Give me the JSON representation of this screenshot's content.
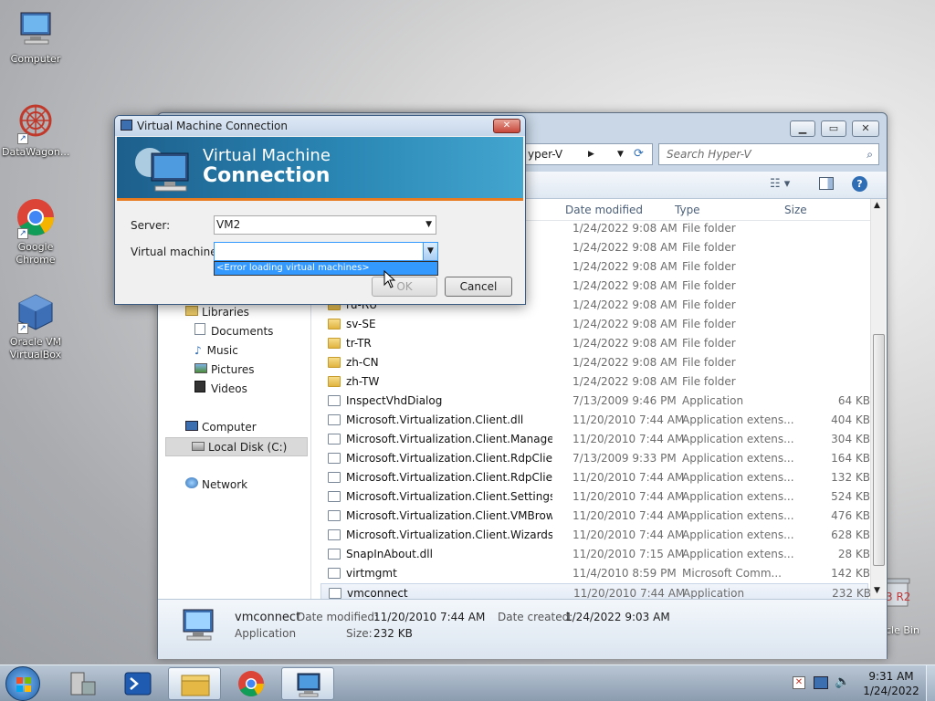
{
  "desktop": {
    "icons": [
      {
        "label": "Computer"
      },
      {
        "label": "DataWagon..."
      },
      {
        "label": "Google Chrome"
      },
      {
        "label": "Oracle VM VirtualBox"
      }
    ],
    "recycle_bin_label": "cle Bin",
    "partial_text_r2": "3 R2"
  },
  "explorer": {
    "address_crumb": "yper-V",
    "search_placeholder": "Search Hyper-V",
    "columns": {
      "date": "Date modified",
      "type": "Type",
      "size": "Size"
    },
    "nav": {
      "libraries": "Libraries",
      "documents": "Documents",
      "music": "Music",
      "pictures": "Pictures",
      "videos": "Videos",
      "computer": "Computer",
      "local_disk": "Local Disk (C:)",
      "network": "Network"
    },
    "rows": [
      {
        "name": "",
        "date": "1/24/2022 9:08 AM",
        "type": "File folder",
        "size": "",
        "icon": "folder"
      },
      {
        "name": "",
        "date": "1/24/2022 9:08 AM",
        "type": "File folder",
        "size": "",
        "icon": "folder"
      },
      {
        "name": "",
        "date": "1/24/2022 9:08 AM",
        "type": "File folder",
        "size": "",
        "icon": "folder"
      },
      {
        "name": "",
        "date": "1/24/2022 9:08 AM",
        "type": "File folder",
        "size": "",
        "icon": "folder"
      },
      {
        "name": "ru-RU",
        "date": "1/24/2022 9:08 AM",
        "type": "File folder",
        "size": "",
        "icon": "folder"
      },
      {
        "name": "sv-SE",
        "date": "1/24/2022 9:08 AM",
        "type": "File folder",
        "size": "",
        "icon": "folder"
      },
      {
        "name": "tr-TR",
        "date": "1/24/2022 9:08 AM",
        "type": "File folder",
        "size": "",
        "icon": "folder"
      },
      {
        "name": "zh-CN",
        "date": "1/24/2022 9:08 AM",
        "type": "File folder",
        "size": "",
        "icon": "folder"
      },
      {
        "name": "zh-TW",
        "date": "1/24/2022 9:08 AM",
        "type": "File folder",
        "size": "",
        "icon": "folder"
      },
      {
        "name": "InspectVhdDialog",
        "date": "7/13/2009 9:46 PM",
        "type": "Application",
        "size": "64 KB",
        "icon": "file"
      },
      {
        "name": "Microsoft.Virtualization.Client.dll",
        "date": "11/20/2010 7:44 AM",
        "type": "Application extens...",
        "size": "404 KB",
        "icon": "file"
      },
      {
        "name": "Microsoft.Virtualization.Client.Managem...",
        "date": "11/20/2010 7:44 AM",
        "type": "Application extens...",
        "size": "304 KB",
        "icon": "file"
      },
      {
        "name": "Microsoft.Virtualization.Client.RdpClient...",
        "date": "7/13/2009 9:33 PM",
        "type": "Application extens...",
        "size": "164 KB",
        "icon": "file"
      },
      {
        "name": "Microsoft.Virtualization.Client.RdpClientI...",
        "date": "11/20/2010 7:44 AM",
        "type": "Application extens...",
        "size": "132 KB",
        "icon": "file"
      },
      {
        "name": "Microsoft.Virtualization.Client.Settings.dll",
        "date": "11/20/2010 7:44 AM",
        "type": "Application extens...",
        "size": "524 KB",
        "icon": "file"
      },
      {
        "name": "Microsoft.Virtualization.Client.VMBrowse...",
        "date": "11/20/2010 7:44 AM",
        "type": "Application extens...",
        "size": "476 KB",
        "icon": "file"
      },
      {
        "name": "Microsoft.Virtualization.Client.Wizards.dll",
        "date": "11/20/2010 7:44 AM",
        "type": "Application extens...",
        "size": "628 KB",
        "icon": "file"
      },
      {
        "name": "SnapInAbout.dll",
        "date": "11/20/2010 7:15 AM",
        "type": "Application extens...",
        "size": "28 KB",
        "icon": "file"
      },
      {
        "name": "virtmgmt",
        "date": "11/4/2010 8:59 PM",
        "type": "Microsoft Comm...",
        "size": "142 KB",
        "icon": "file"
      },
      {
        "name": "vmconnect",
        "date": "11/20/2010 7:44 AM",
        "type": "Application",
        "size": "232 KB",
        "icon": "file"
      }
    ],
    "details": {
      "name": "vmconnect",
      "type": "Application",
      "date_modified_label": "Date modified:",
      "date_modified": "11/20/2010 7:44 AM",
      "date_created_label": "Date created:",
      "date_created": "1/24/2022 9:03 AM",
      "size_label": "Size:",
      "size": "232 KB"
    }
  },
  "dialog": {
    "title": "Virtual Machine Connection",
    "banner_line1": "Virtual Machine",
    "banner_line2": "Connection",
    "server_label": "Server:",
    "server_value": "VM2",
    "vm_label": "Virtual machine:",
    "vm_value": "",
    "dropdown_item": "<Error loading virtual machines>",
    "ok_label": "OK",
    "cancel_label": "Cancel",
    "close_glyph": "✕"
  },
  "taskbar": {
    "time": "9:31 AM",
    "date": "1/24/2022"
  },
  "colors": {
    "banner": "#2a86b4",
    "selection": "#3399ff",
    "close_button": "#c7473a"
  }
}
